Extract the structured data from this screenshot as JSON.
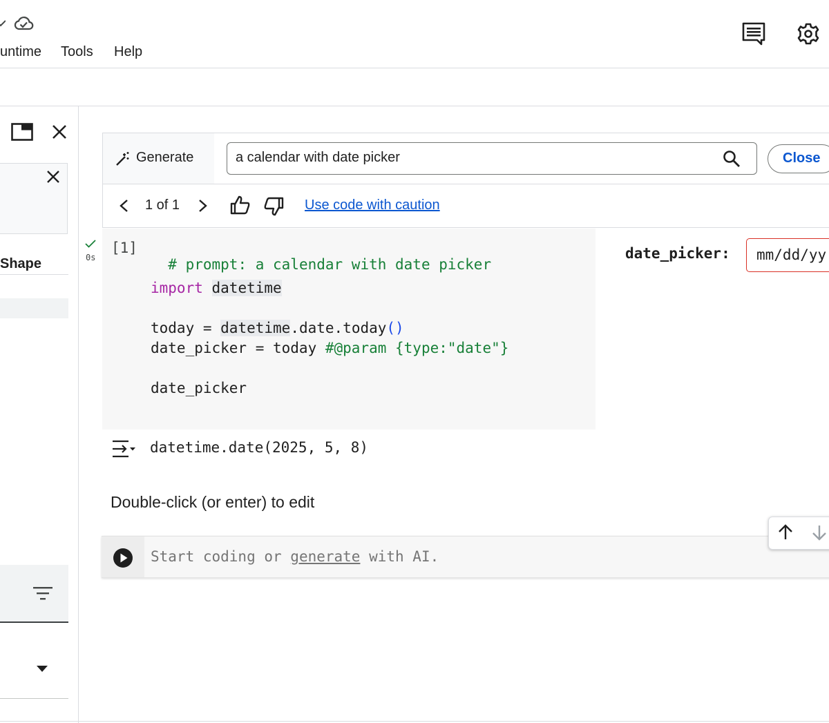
{
  "menu": {
    "items": [
      {
        "label": "untime"
      },
      {
        "label": "Tools"
      },
      {
        "label": "Help"
      }
    ]
  },
  "generate": {
    "label": "Generate",
    "prompt_value": "a calendar with date picker",
    "close_label": "Close",
    "pager_text": "1 of 1",
    "caution_link": "Use code with caution"
  },
  "sidebar": {
    "column_label": "Shape"
  },
  "code_cell": {
    "exec_count": "[1]",
    "exec_time": "0s",
    "lines": {
      "comment": "# prompt: a calendar with date picker",
      "import_kw": "import",
      "import_mod": "datetime",
      "today_lhs": "today = ",
      "today_mod": "datetime",
      "today_call": ".date.today",
      "today_parens": "()",
      "picker_lhs": "date_picker = today ",
      "picker_param": "#@param {type:\"date\"}",
      "picker_var": "date_picker"
    },
    "param_label": "date_picker:",
    "param_value": "mm/dd/yy"
  },
  "output": {
    "text": "datetime.date(2025, 5, 8)"
  },
  "text_cell": {
    "text": "Double-click (or enter) to edit"
  },
  "empty_cell": {
    "placeholder_pre": "Start coding or ",
    "placeholder_link": "generate",
    "placeholder_post": " with AI."
  },
  "colors": {
    "accent": "#0b57d0",
    "comment": "#188038",
    "keyword": "#a626a4",
    "error_border": "#d93025"
  }
}
